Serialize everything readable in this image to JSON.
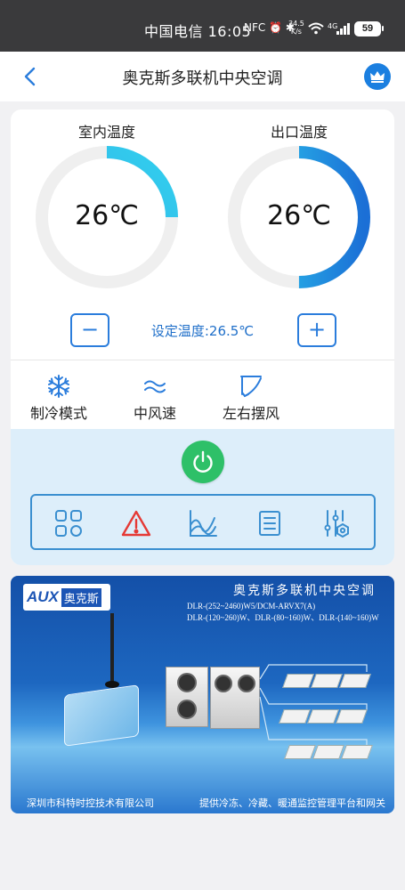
{
  "status_bar": {
    "carrier_time": "中国电信 16:05",
    "icons": "NFC ⏰ ✱",
    "net_speed_value": "34.5",
    "net_speed_unit": "K/s",
    "network": "4G",
    "battery": "59"
  },
  "header": {
    "title": "奥克斯多联机中央空调"
  },
  "gauges": [
    {
      "label": "室内温度",
      "value": "26℃",
      "fill_fraction": 0.25
    },
    {
      "label": "出口温度",
      "value": "26℃",
      "fill_fraction": 0.5
    }
  ],
  "setpoint": {
    "text": "设定温度:26.5℃",
    "minus_label": "−",
    "plus_label": "+"
  },
  "modes": [
    {
      "label": "制冷模式",
      "icon": "snowflake-icon"
    },
    {
      "label": "中风速",
      "icon": "wind-icon"
    },
    {
      "label": "左右摆风",
      "icon": "swing-icon"
    }
  ],
  "toolbar": [
    {
      "icon": "grid-apps-icon"
    },
    {
      "icon": "warning-icon"
    },
    {
      "icon": "chart-curve-icon"
    },
    {
      "icon": "list-document-icon"
    },
    {
      "icon": "settings-sliders-icon"
    }
  ],
  "banner": {
    "logo_text": "AUX",
    "logo_cn": "奥克斯",
    "title": "奥克斯多联机中央空调",
    "model_line1": "DLR-(252~2460)W5/DCM-ARVX7(A)",
    "model_line2": "DLR-(120~260)W、DLR-(80~160)W、DLR-(140~160)W",
    "company": "深圳市科特时控技术有限公司",
    "slogan": "提供冷冻、冷藏、暖通监控管理平台和网关"
  },
  "colors": {
    "accent": "#2b7ddc",
    "gauge_arc": "#29aee8",
    "power": "#2ec068",
    "warning": "#e53935"
  }
}
